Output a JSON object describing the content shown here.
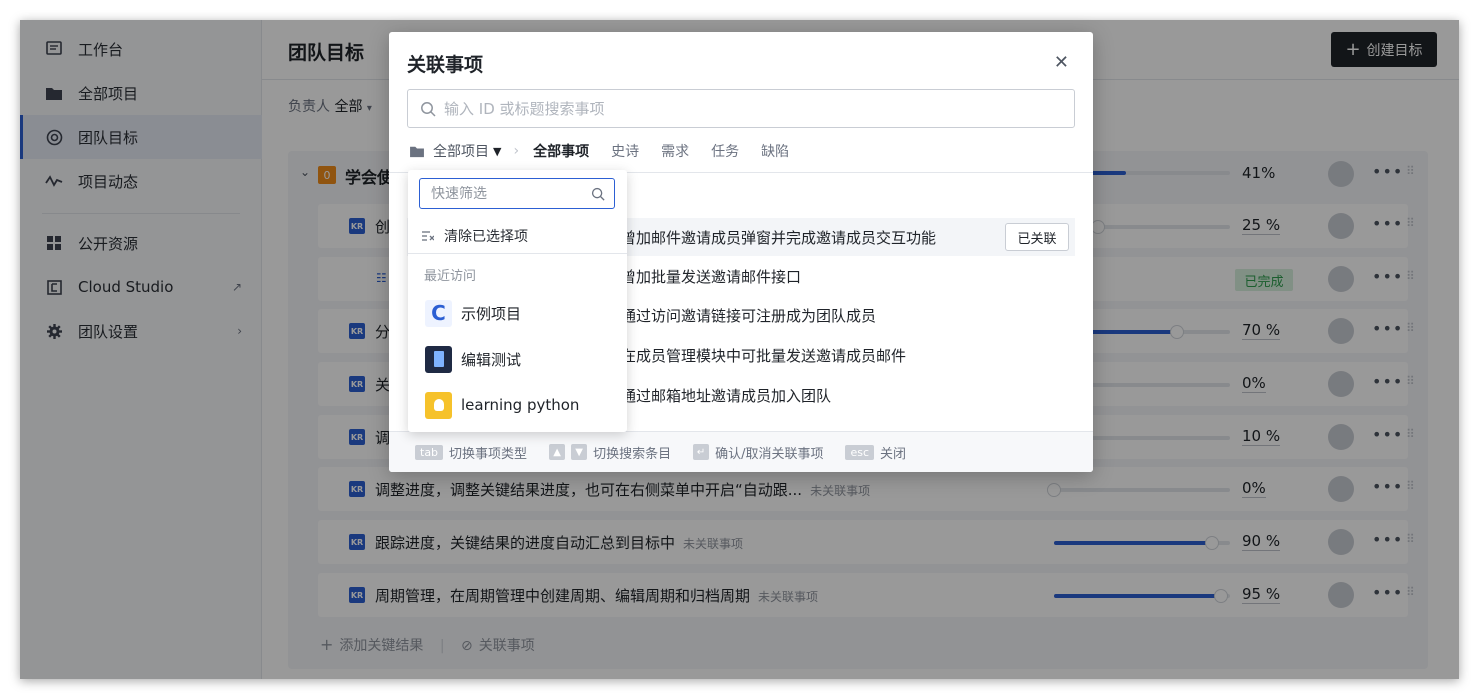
{
  "sidebar": {
    "items": [
      {
        "label": "工作台",
        "icon": "workbench-icon"
      },
      {
        "label": "全部项目",
        "icon": "folder-icon"
      },
      {
        "label": "团队目标",
        "icon": "target-icon"
      },
      {
        "label": "项目动态",
        "icon": "activity-icon"
      },
      {
        "label": "公开资源",
        "icon": "grid-icon"
      },
      {
        "label": "Cloud Studio",
        "icon": "cloud-studio-icon"
      },
      {
        "label": "团队设置",
        "icon": "gear-icon"
      }
    ]
  },
  "header": {
    "title": "团队目标",
    "create_label": "创建目标"
  },
  "filter": {
    "owner_label": "负责人",
    "owner_value": "全部"
  },
  "goal": {
    "badge": "0",
    "title": "学会使"
  },
  "rows": [
    {
      "title": "创",
      "subtitle": "",
      "progress": 25,
      "pct": "25 %"
    },
    {
      "title": "",
      "subtitle": "",
      "status": "已完成"
    },
    {
      "title": "分",
      "subtitle": "",
      "progress": 70,
      "pct": "70 %"
    },
    {
      "title": "关",
      "subtitle": "",
      "progress": 0,
      "pct": "0%"
    },
    {
      "title": "调",
      "subtitle": "",
      "progress": 10,
      "pct": "10 %"
    },
    {
      "title": "调整进度，调整关键结果进度，也可在右侧菜单中开启“自动跟...",
      "subtitle": "未关联事项",
      "progress": 0,
      "pct": "0%"
    },
    {
      "title": "跟踪进度，关键结果的进度自动汇总到目标中",
      "subtitle": "未关联事项",
      "progress": 90,
      "pct": "90 %"
    },
    {
      "title": "周期管理，在周期管理中创建周期、编辑周期和归档周期",
      "subtitle": "未关联事项",
      "progress": 95,
      "pct": "95 %"
    }
  ],
  "goal_pct": "41%",
  "goal_progress": 41,
  "footer_actions": {
    "add_kr": "添加关键结果",
    "link_items": "关联事项"
  },
  "modal": {
    "title": "关联事项",
    "search_placeholder": "输入 ID 或标题搜索事项",
    "project_selector": "全部项目",
    "tabs": [
      "全部事项",
      "史诗",
      "需求",
      "任务",
      "缺陷"
    ],
    "items": [
      {
        "text": "曾加邮件邀请成员弹窗并完成邀请成员交互功能",
        "linked": "已关联"
      },
      {
        "text": "曾加批量发送邀请邮件接口"
      },
      {
        "text": "通过访问邀请链接可注册成为团队成员"
      },
      {
        "text": "在成员管理模块中可批量发送邀请成员邮件"
      },
      {
        "text": "通过邮箱地址邀请成员加入团队"
      }
    ],
    "footer": {
      "tab_key": "tab",
      "tab_text": "切换事项类型",
      "arrow_text": "切换搜索条目",
      "enter_text": "确认/取消关联事项",
      "esc_key": "esc",
      "esc_text": "关闭"
    }
  },
  "dropdown": {
    "search_placeholder": "快速筛选",
    "clear_label": "清除已选择项",
    "recent_label": "最近访问",
    "projects": [
      {
        "name": "示例项目"
      },
      {
        "name": "编辑测试"
      },
      {
        "name": "learning python"
      }
    ]
  },
  "colors": {
    "accent": "#2c5fd3",
    "done_bg": "#d8f0de",
    "done_text": "#2e9d4e",
    "dark_button": "#1f2329"
  }
}
